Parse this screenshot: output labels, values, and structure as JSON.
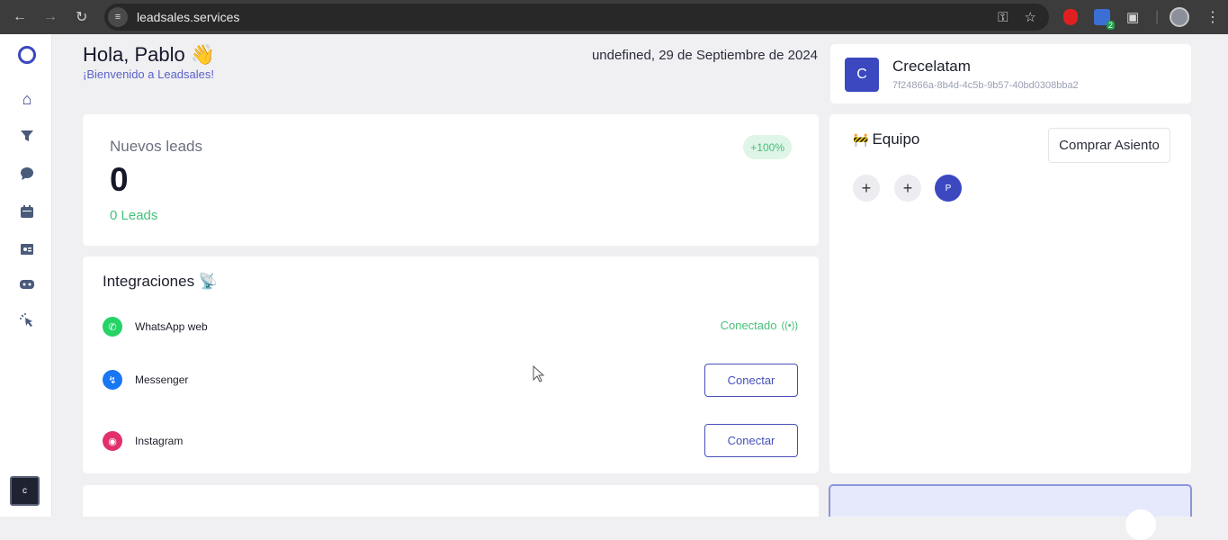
{
  "browser": {
    "url": "leadsales.services",
    "extension_badge": "2"
  },
  "sidebar": {
    "user_initial": "c"
  },
  "header": {
    "greeting": "Hola, Pablo 👋",
    "subtitle": "¡Bienvenido a Leadsales!",
    "date": "undefined, 29 de Septiembre de 2024"
  },
  "account": {
    "initial": "C",
    "name": "Crecelatam",
    "id": "7f24866a-8b4d-4c5b-9b57-40bd0308bba2"
  },
  "leads": {
    "title": "Nuevos leads",
    "badge": "+100%",
    "count": "0",
    "subtext": "0 Leads"
  },
  "integrations": {
    "title": "Integraciones 📡",
    "items": [
      {
        "name": "WhatsApp web",
        "status": "Conectado",
        "status_icon": "signal-icon",
        "color": "#25d366"
      },
      {
        "name": "Messenger",
        "action": "Conectar",
        "color": "#1877f2"
      },
      {
        "name": "Instagram",
        "action": "Conectar",
        "color": "#e1306c"
      }
    ]
  },
  "team": {
    "title": "Equipo",
    "buy_label": "Comprar Asiento",
    "member_initial": "P"
  },
  "colors": {
    "primary": "#4650b8",
    "success": "#38c172",
    "badge_bg": "#dff5e7"
  }
}
